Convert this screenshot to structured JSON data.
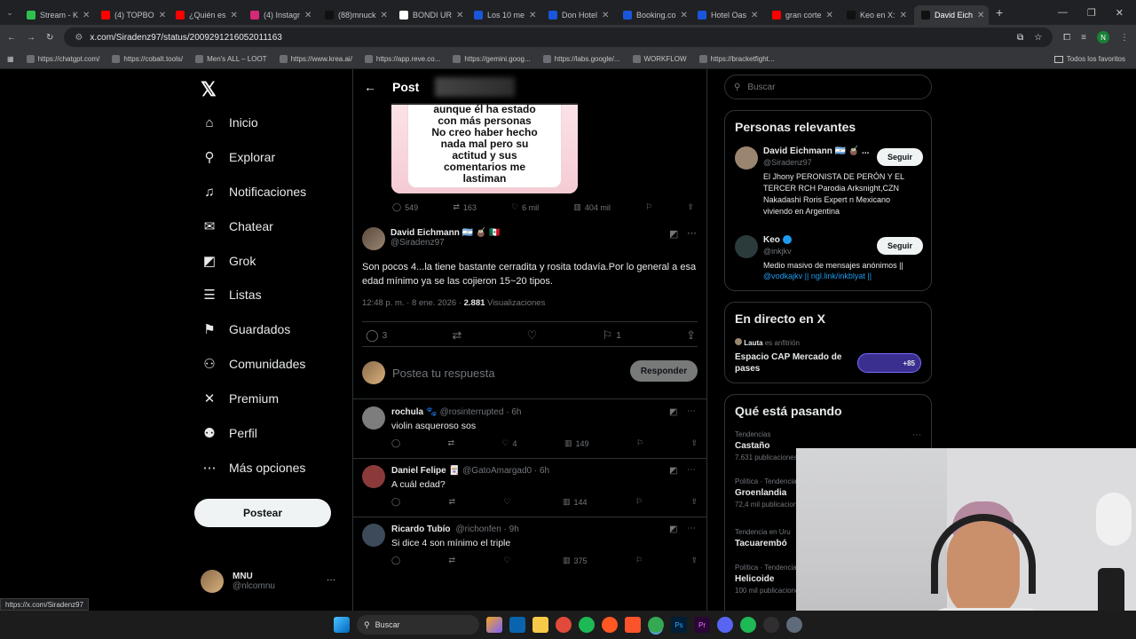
{
  "browser": {
    "tabs": [
      {
        "label": "Stream - K",
        "color": "#2fbf4f"
      },
      {
        "label": "(4) TOPBO",
        "color": "#ff0000"
      },
      {
        "label": "¿Quién es",
        "color": "#ff0000"
      },
      {
        "label": "(4) Instagr",
        "color": "#d62976"
      },
      {
        "label": "(88)mnuck",
        "color": "#111111"
      },
      {
        "label": "BONDI UR",
        "color": "#ffffff"
      },
      {
        "label": "Los 10 me",
        "color": "#1a56db"
      },
      {
        "label": "Don Hotel",
        "color": "#1a56db"
      },
      {
        "label": "Booking.co",
        "color": "#1a56db"
      },
      {
        "label": "Hotel Oas",
        "color": "#1a56db"
      },
      {
        "label": "gran corte",
        "color": "#ff0000"
      },
      {
        "label": "Keo en X:",
        "color": "#111111"
      },
      {
        "label": "David Eich",
        "color": "#111111"
      }
    ],
    "url": "x.com/Siradenz97/status/2009291216052011163",
    "bookmarks": [
      "https://chatgpt.com/",
      "https://cobalt.tools/",
      "Men's ALL – LOOT",
      "https://www.krea.ai/",
      "https://app.reve.co...",
      "https://gemini.goog...",
      "https://labs.google/...",
      "WORKFLOW",
      "https://bracketfight..."
    ],
    "all_favorites": "Todos los favoritos",
    "status_url": "https://x.com/Siradenz97"
  },
  "nav": {
    "items": [
      {
        "label": "Inicio",
        "icon": "home-icon",
        "glyph": "⌂"
      },
      {
        "label": "Explorar",
        "icon": "search-icon",
        "glyph": "⚲"
      },
      {
        "label": "Notificaciones",
        "icon": "bell-icon",
        "glyph": "♫"
      },
      {
        "label": "Chatear",
        "icon": "mail-icon",
        "glyph": "✉"
      },
      {
        "label": "Grok",
        "icon": "grok-icon",
        "glyph": "◩"
      },
      {
        "label": "Listas",
        "icon": "list-icon",
        "glyph": "☰"
      },
      {
        "label": "Guardados",
        "icon": "bookmark-icon",
        "glyph": "⚑"
      },
      {
        "label": "Comunidades",
        "icon": "people-icon",
        "glyph": "⚇"
      },
      {
        "label": "Premium",
        "icon": "x-logo-icon",
        "glyph": "✕"
      },
      {
        "label": "Perfil",
        "icon": "person-icon",
        "glyph": "⚉"
      },
      {
        "label": "Más opciones",
        "icon": "more-icon",
        "glyph": "⋯"
      }
    ],
    "post_button": "Postear",
    "user": {
      "name": "MNU",
      "handle": "@nlcomnu",
      "more": "···"
    }
  },
  "header": {
    "title": "Post",
    "back": "←"
  },
  "quoted_card": {
    "lines": [
      "aunque él ha estado",
      "con más personas",
      "No creo haber hecho",
      "nada mal pero su",
      "actitud y sus",
      "comentarios me",
      "lastiman"
    ]
  },
  "prev_actions": {
    "replies": "549",
    "reposts": "163",
    "likes": "6 mil",
    "views": "404 mil"
  },
  "main_post": {
    "name": "David Eichmann 🇦🇷 🧉 🇲🇽",
    "handle": "@Siradenz97",
    "text": "Son pocos 4...la tiene bastante cerradita y rosita todavía.Por lo general a esa edad mínimo ya se las cojieron 15~20 tipos.",
    "time": "12:48 p. m. · 8 ene. 2026 ·",
    "views_count": "2.881",
    "views_label": "Visualizaciones",
    "replies": "3",
    "bookmarks": "1"
  },
  "reply_box": {
    "placeholder": "Postea tu respuesta",
    "button": "Responder"
  },
  "replies": [
    {
      "name": "rochula",
      "emoji": "🐾",
      "handle": "@rosinterrupted · 6h",
      "text": "violin asqueroso sos",
      "likes": "4",
      "views": "149"
    },
    {
      "name": "Daniel Felipe",
      "emoji": "🃏",
      "handle": "@GatoAmargad0 · 6h",
      "text": "A cuál edad?",
      "likes": "",
      "views": "144"
    },
    {
      "name": "Ricardo Tubío",
      "emoji": "",
      "handle": "@richonfen · 9h",
      "text": "Si dice 4 son mínimo el triple",
      "likes": "",
      "views": "375"
    }
  ],
  "sidebar": {
    "search_placeholder": "Buscar",
    "relevant_title": "Personas relevantes",
    "people": [
      {
        "name": "David Eichmann 🇦🇷 🧉 ...",
        "handle": "@Siradenz97",
        "bio": "El Jhony PERONISTA DE PERÓN Y EL TERCER RCH Parodia Arksnight,CZN Nakadashi Roris Expert n Mexicano viviendo en Argentina",
        "follow": "Seguir"
      },
      {
        "name": "Keo",
        "handle": "@inkjkv",
        "bio": "Medio masivo de mensajes anónimos ||",
        "links": "@vodkajkv || ngl.link/inkblyat ||",
        "follow": "Seguir"
      }
    ],
    "live_title": "En directo en X",
    "live": {
      "host": "Lauta",
      "host_suffix": "es anfitrión",
      "title": "Espacio CAP Mercado de pases",
      "count": "+85"
    },
    "trending_title": "Qué está pasando",
    "trends": [
      {
        "category": "Tendencias",
        "name": "Castaño",
        "posts": "7.631 publicaciones"
      },
      {
        "category": "Política · Tendencia",
        "name": "Groenlandia",
        "posts": "72,4 mil publicaciones"
      },
      {
        "category": "Tendencia en Uru",
        "name": "Tacuarembó",
        "posts": ""
      },
      {
        "category": "Política · Tendencia",
        "name": "Helicoide",
        "posts": "100 mil publicaciones"
      }
    ]
  },
  "taskbar": {
    "search": "Buscar"
  }
}
